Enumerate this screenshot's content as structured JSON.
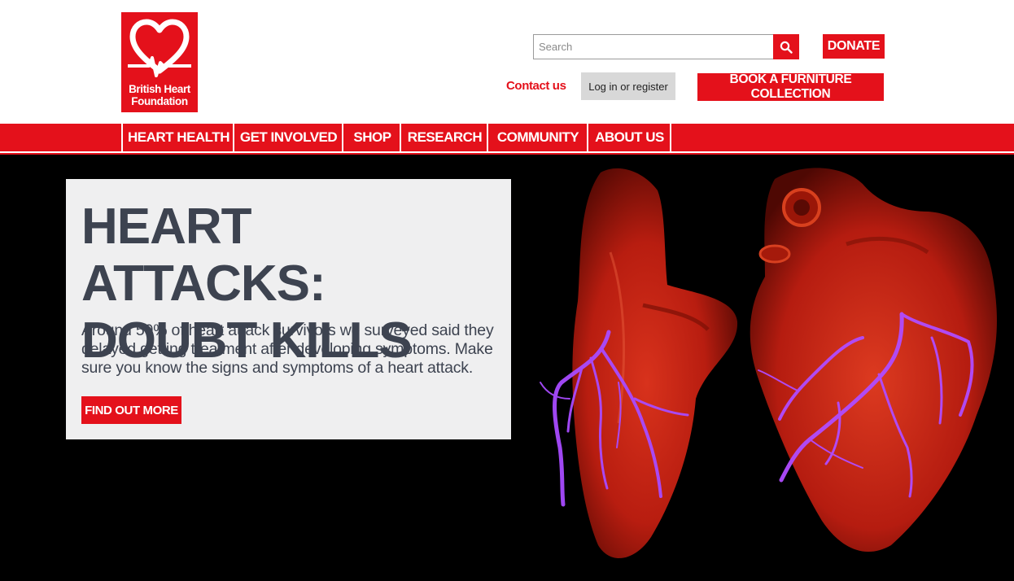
{
  "brand": {
    "logo_text_line1": "British Heart",
    "logo_text_line2": "Foundation",
    "color": "#e4111b"
  },
  "header": {
    "search": {
      "placeholder": "Search",
      "icon": "search-icon"
    },
    "donate_label": "DONATE",
    "contact_label": "Contact us",
    "login_label": "Log in or register",
    "book_label": "BOOK A FURNITURE COLLECTION"
  },
  "nav": {
    "items": [
      {
        "label": "HEART HEALTH"
      },
      {
        "label": "GET INVOLVED"
      },
      {
        "label": "SHOP"
      },
      {
        "label": "RESEARCH"
      },
      {
        "label": "COMMUNITY"
      },
      {
        "label": "ABOUT US"
      }
    ]
  },
  "hero": {
    "title_line1": "HEART ATTACKS:",
    "title_line2": "DOUBT KILLS",
    "body": "Around 50% of heart attack survivors we surveyed said they delayed getting treatment after developing symptoms. Make sure you know the signs and symptoms of a heart attack.",
    "cta_label": "FIND OUT MORE",
    "image": "heart-scan-image"
  },
  "colors": {
    "accent": "#e4111b",
    "hero_bg": "#000000",
    "card_bg": "#efeff0",
    "text_dark": "#3d4350",
    "vessel": "#b04cff"
  }
}
